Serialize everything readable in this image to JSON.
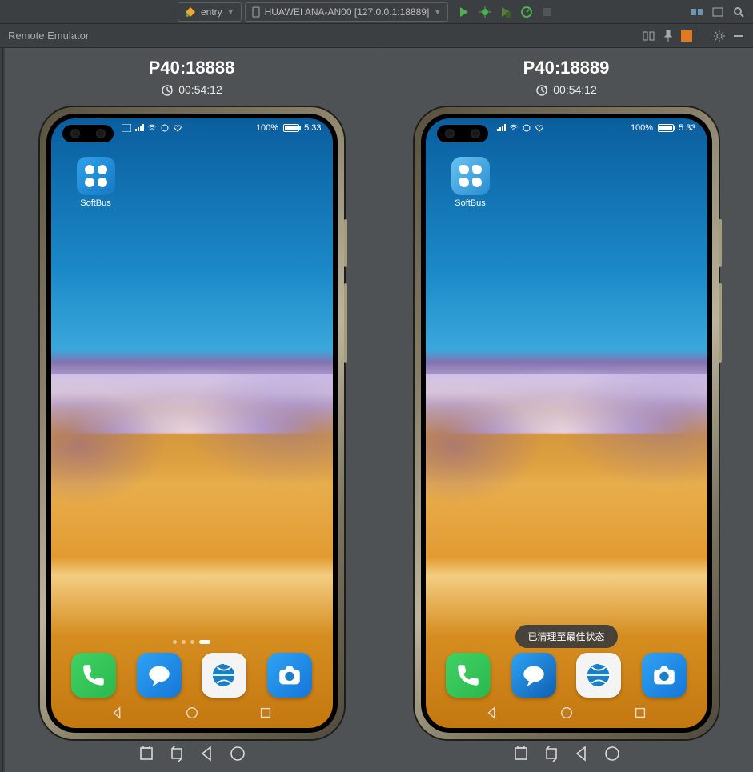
{
  "toolbar": {
    "config_selector": {
      "label": "entry",
      "icon_color_a": "#f0a732",
      "icon_color_b": "#4caf50"
    },
    "device_selector": {
      "label": "HUAWEI ANA-AN00 [127.0.0.1:18889]"
    },
    "actions": {
      "run": "run-icon",
      "debug": "debug-icon",
      "coverage": "coverage-icon",
      "profile": "profile-icon",
      "stop": "stop-icon"
    }
  },
  "secondary_bar": {
    "title": "Remote Emulator"
  },
  "emulators": [
    {
      "title": "P40:18888",
      "timer": "00:54:12",
      "status": {
        "battery_pct": "100%",
        "time": "5:33"
      },
      "app": {
        "name": "SoftBus"
      },
      "dock": [
        "phone",
        "messages",
        "browser",
        "camera"
      ],
      "page_dots": 4,
      "toast": null
    },
    {
      "title": "P40:18889",
      "timer": "00:54:12",
      "status": {
        "battery_pct": "100%",
        "time": "5:33"
      },
      "app": {
        "name": "SoftBus"
      },
      "dock": [
        "phone",
        "messages",
        "browser",
        "camera"
      ],
      "page_dots": 0,
      "toast": "已清理至最佳状态"
    }
  ]
}
